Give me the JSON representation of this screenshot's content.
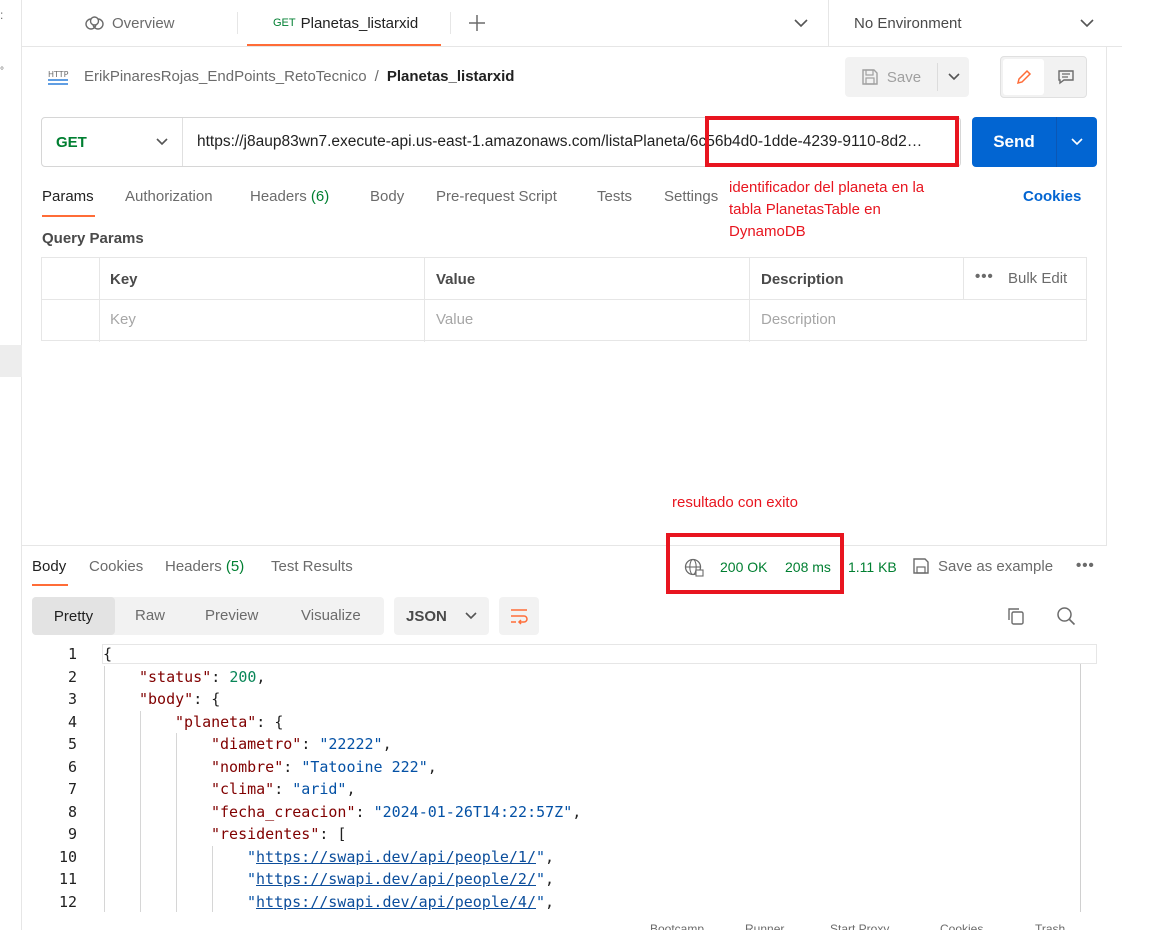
{
  "tabs": {
    "overview_label": "Overview",
    "active_method": "GET",
    "active_label": "Planetas_listarxid",
    "environment": "No Environment"
  },
  "breadcrumb": {
    "collection": "ErikPinaresRojas_EndPoints_RetoTecnico",
    "separator": "/",
    "request": "Planetas_listarxid",
    "save_label": "Save"
  },
  "request": {
    "method": "GET",
    "url": "https://j8aup83wn7.execute-api.us-east-1.amazonaws.com/listaPlaneta/6c56b4d0-1dde-4239-9110-8d2…",
    "send_label": "Send"
  },
  "request_tabs": {
    "params": "Params",
    "authorization": "Authorization",
    "headers": "Headers",
    "headers_count": "(6)",
    "body": "Body",
    "prerequest": "Pre-request Script",
    "tests": "Tests",
    "settings": "Settings",
    "cookies": "Cookies"
  },
  "annotations": {
    "id_note_1": "identificador del planeta en la",
    "id_note_2": "tabla PlanetasTable en",
    "id_note_3": "DynamoDB",
    "result_note": "resultado con exito"
  },
  "query_params": {
    "title": "Query Params",
    "col_key": "Key",
    "col_value": "Value",
    "col_description": "Description",
    "bulk_edit": "Bulk Edit",
    "ph_key": "Key",
    "ph_value": "Value",
    "ph_description": "Description"
  },
  "response_tabs": {
    "body": "Body",
    "cookies": "Cookies",
    "headers": "Headers",
    "headers_count": "(5)",
    "test_results": "Test Results",
    "status": "200 OK",
    "time": "208 ms",
    "size": "1.11 KB",
    "save_example": "Save as example"
  },
  "view_modes": {
    "pretty": "Pretty",
    "raw": "Raw",
    "preview": "Preview",
    "visualize": "Visualize",
    "format": "JSON"
  },
  "code_lines": [
    {
      "n": "1",
      "indent": 0,
      "parts": [
        [
          "p",
          "{"
        ]
      ]
    },
    {
      "n": "2",
      "indent": 1,
      "parts": [
        [
          "k",
          "\"status\""
        ],
        [
          "p",
          ": "
        ],
        [
          "num",
          "200"
        ],
        [
          "p",
          ","
        ]
      ]
    },
    {
      "n": "3",
      "indent": 1,
      "parts": [
        [
          "k",
          "\"body\""
        ],
        [
          "p",
          ": {"
        ]
      ]
    },
    {
      "n": "4",
      "indent": 2,
      "parts": [
        [
          "k",
          "\"planeta\""
        ],
        [
          "p",
          ": {"
        ]
      ]
    },
    {
      "n": "5",
      "indent": 3,
      "parts": [
        [
          "k",
          "\"diametro\""
        ],
        [
          "p",
          ": "
        ],
        [
          "s",
          "\"22222\""
        ],
        [
          "p",
          ","
        ]
      ]
    },
    {
      "n": "6",
      "indent": 3,
      "parts": [
        [
          "k",
          "\"nombre\""
        ],
        [
          "p",
          ": "
        ],
        [
          "s",
          "\"Tatooine 222\""
        ],
        [
          "p",
          ","
        ]
      ]
    },
    {
      "n": "7",
      "indent": 3,
      "parts": [
        [
          "k",
          "\"clima\""
        ],
        [
          "p",
          ": "
        ],
        [
          "s",
          "\"arid\""
        ],
        [
          "p",
          ","
        ]
      ]
    },
    {
      "n": "8",
      "indent": 3,
      "parts": [
        [
          "k",
          "\"fecha_creacion\""
        ],
        [
          "p",
          ": "
        ],
        [
          "s",
          "\"2024-01-26T14:22:57Z\""
        ],
        [
          "p",
          ","
        ]
      ]
    },
    {
      "n": "9",
      "indent": 3,
      "parts": [
        [
          "k",
          "\"residentes\""
        ],
        [
          "p",
          ": ["
        ]
      ]
    },
    {
      "n": "10",
      "indent": 4,
      "parts": [
        [
          "s",
          "\""
        ],
        [
          "l",
          "https://swapi.dev/api/people/1/"
        ],
        [
          "s",
          "\""
        ],
        [
          "p",
          ","
        ]
      ]
    },
    {
      "n": "11",
      "indent": 4,
      "parts": [
        [
          "s",
          "\""
        ],
        [
          "l",
          "https://swapi.dev/api/people/2/"
        ],
        [
          "s",
          "\""
        ],
        [
          "p",
          ","
        ]
      ]
    },
    {
      "n": "12",
      "indent": 4,
      "parts": [
        [
          "s",
          "\""
        ],
        [
          "l",
          "https://swapi.dev/api/people/4/"
        ],
        [
          "s",
          "\""
        ],
        [
          "p",
          ","
        ]
      ]
    }
  ],
  "status_bar": {
    "bootcamp": "Bootcamp",
    "runner": "Runner",
    "proxy": "Start Proxy",
    "cookies": "Cookies",
    "trash": "Trash"
  },
  "colors": {
    "accent": "#ff6c37",
    "send": "#0265d2",
    "annotation_red": "#e8151f",
    "status_green": "#007f31",
    "json_key": "#800000",
    "json_string": "#0451a5",
    "json_number": "#098658"
  }
}
